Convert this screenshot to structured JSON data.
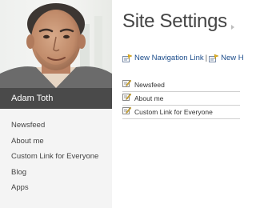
{
  "profile": {
    "name": "Adam Toth"
  },
  "nav": {
    "items": [
      {
        "label": "Newsfeed"
      },
      {
        "label": "About me"
      },
      {
        "label": "Custom Link for Everyone"
      },
      {
        "label": "Blog"
      },
      {
        "label": "Apps"
      }
    ]
  },
  "main": {
    "title": "Site Settings",
    "toolbar": {
      "new_nav_link": "New Navigation Link",
      "separator": "|",
      "new_heading": "New H"
    },
    "items": [
      {
        "label": "Newsfeed"
      },
      {
        "label": "About me"
      },
      {
        "label": "Custom Link for Everyone"
      }
    ]
  },
  "colors": {
    "sidebar_bg": "#f4f4f4",
    "name_bar_bg": "#4a4a4a",
    "link_blue": "#1a4b8a",
    "title_text": "#444444"
  },
  "icons": {
    "toolbar_link_icon": "new-link-icon",
    "item_icon": "edit-link-icon",
    "title_arrow": "chevron-right-icon"
  }
}
